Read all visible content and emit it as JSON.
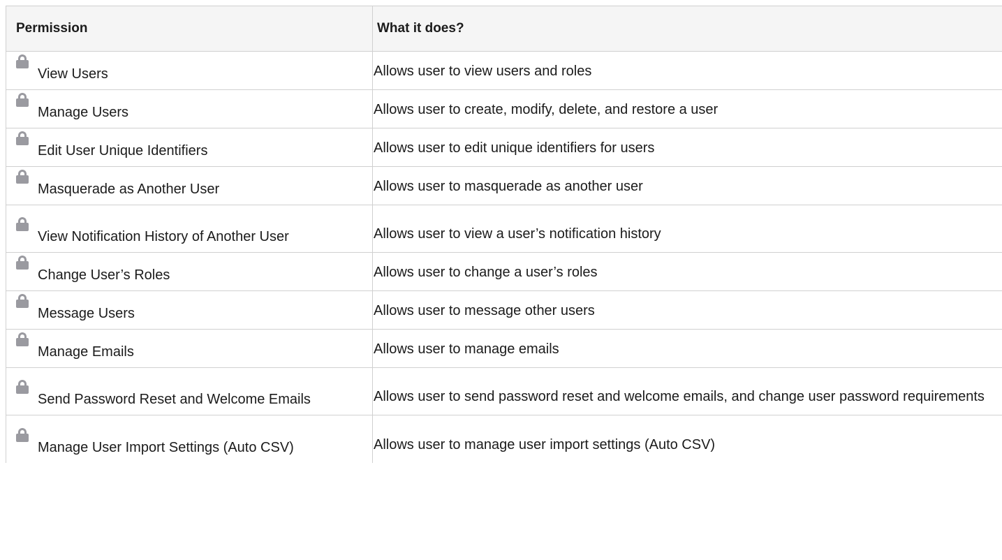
{
  "table": {
    "headers": {
      "permission": "Permission",
      "description": "What it does?"
    },
    "rows": [
      {
        "icon": "lock-icon",
        "permission": "View Users",
        "description": "Allows user to view users and roles"
      },
      {
        "icon": "lock-icon",
        "permission": "Manage Users",
        "description": "Allows user to create, modify, delete, and restore a user"
      },
      {
        "icon": "lock-icon",
        "permission": "Edit User Unique Identifiers",
        "description": "Allows user to edit unique identifiers for users"
      },
      {
        "icon": "lock-icon",
        "permission": "Masquerade as Another User",
        "description": "Allows user to masquerade as another user"
      },
      {
        "icon": "lock-icon",
        "permission": "View Notification History of Another User",
        "description": "Allows user to view a user’s notification history"
      },
      {
        "icon": "lock-icon",
        "permission": "Change User’s Roles",
        "description": "Allows user to change a user’s roles"
      },
      {
        "icon": "lock-icon",
        "permission": "Message Users",
        "description": "Allows user to message other users"
      },
      {
        "icon": "lock-icon",
        "permission": "Manage Emails",
        "description": "Allows user to manage emails"
      },
      {
        "icon": "lock-icon",
        "permission": "Send Password Reset and Welcome Emails",
        "description": "Allows user to send password reset and welcome emails, and change user password requirements"
      },
      {
        "icon": "lock-icon",
        "permission": "Manage User Import Settings (Auto CSV)",
        "description": "Allows user to manage user import settings (Auto CSV)"
      }
    ]
  },
  "colors": {
    "header_bg": "#f5f5f5",
    "border": "#d0d0d0",
    "lock_icon": "#9a9aa0"
  }
}
